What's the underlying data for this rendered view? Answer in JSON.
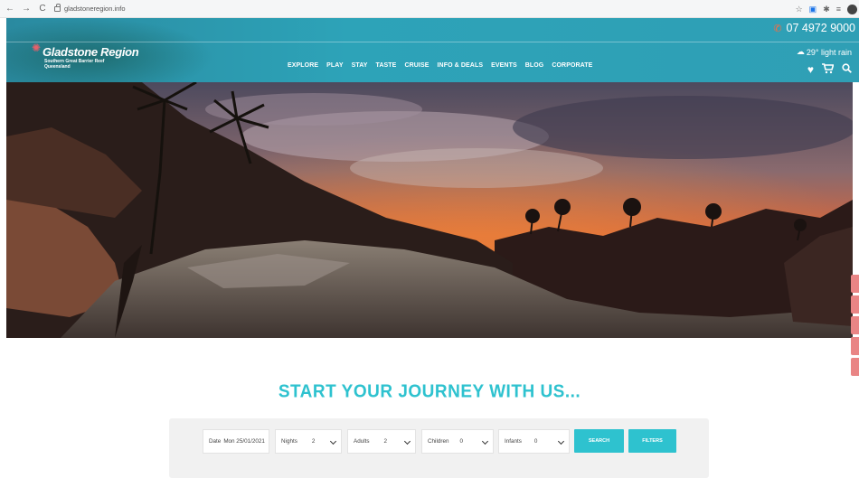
{
  "browser": {
    "url": "gladstoneregion.info",
    "back_icon": "arrow-left",
    "forward_icon": "arrow-right",
    "reload_icon": "reload",
    "toolbar_icons": [
      "star-icon",
      "extension-icon",
      "puzzle-icon",
      "menu-icon",
      "profile-icon"
    ]
  },
  "header": {
    "logo_title": "Gladstone Region",
    "logo_sub_1": "Southern Great Barrier Reef",
    "logo_sub_2": "Queensland",
    "phone": "07 4972 9000",
    "weather": "29° light rain",
    "nav": [
      "EXPLORE",
      "PLAY",
      "STAY",
      "TASTE",
      "CRUISE",
      "INFO & DEALS",
      "EVENTS",
      "BLOG",
      "CORPORATE"
    ],
    "colors": {
      "bar": "#2da3b8",
      "phone_icon": "#ff6a3d"
    }
  },
  "hero": {
    "image": "sunset over rocky outcrop",
    "mute_icon": "speaker-icon"
  },
  "side_tabs": 5,
  "journey": {
    "headline": "START YOUR JOURNEY WITH US...",
    "accent": "#2ec2cf",
    "date_label": "Date",
    "date_value": "Mon 25/01/2021",
    "nights_label": "Nights",
    "nights_value": "2",
    "adults_label": "Adults",
    "adults_value": "2",
    "children_label": "Children",
    "children_value": "0",
    "infants_label": "Infants",
    "infants_value": "0",
    "search_label": "SEARCH",
    "filters_label": "FILTERS"
  }
}
